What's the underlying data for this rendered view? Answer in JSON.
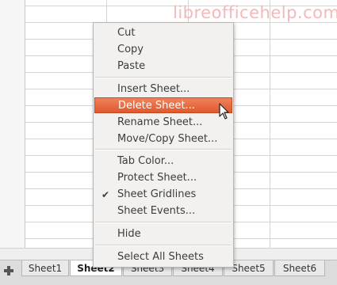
{
  "watermark": "libreofficehelp.com",
  "context_menu": {
    "items": [
      {
        "label": "Cut",
        "checked": false,
        "highlighted": false
      },
      {
        "label": "Copy",
        "checked": false,
        "highlighted": false
      },
      {
        "label": "Paste",
        "checked": false,
        "highlighted": false
      },
      {
        "label": "Insert Sheet...",
        "checked": false,
        "highlighted": false
      },
      {
        "label": "Delete Sheet...",
        "checked": false,
        "highlighted": true
      },
      {
        "label": "Rename Sheet...",
        "checked": false,
        "highlighted": false
      },
      {
        "label": "Move/Copy Sheet...",
        "checked": false,
        "highlighted": false
      },
      {
        "label": "Tab Color...",
        "checked": false,
        "highlighted": false
      },
      {
        "label": "Protect Sheet...",
        "checked": false,
        "highlighted": false
      },
      {
        "label": "Sheet Gridlines",
        "checked": true,
        "highlighted": false
      },
      {
        "label": "Sheet Events...",
        "checked": false,
        "highlighted": false
      },
      {
        "label": "Hide",
        "checked": false,
        "highlighted": false
      },
      {
        "label": "Select All Sheets",
        "checked": false,
        "highlighted": false
      }
    ],
    "check_glyph": "✔"
  },
  "tabs": [
    {
      "label": "Sheet1",
      "active": false
    },
    {
      "label": "Sheet2",
      "active": true
    },
    {
      "label": "Sheet3",
      "active": false
    },
    {
      "label": "Sheet4",
      "active": false
    },
    {
      "label": "Sheet5",
      "active": false
    },
    {
      "label": "Sheet6",
      "active": false
    }
  ],
  "icons": {
    "add_sheet": "add-sheet-icon",
    "check": "check-icon",
    "cursor": "mouse-cursor-icon"
  },
  "colors": {
    "highlight": "#e86a3f",
    "menu_bg": "#f2f1f0",
    "tabbar_bg": "#dcdcdc",
    "watermark": "#f3b8b8"
  }
}
